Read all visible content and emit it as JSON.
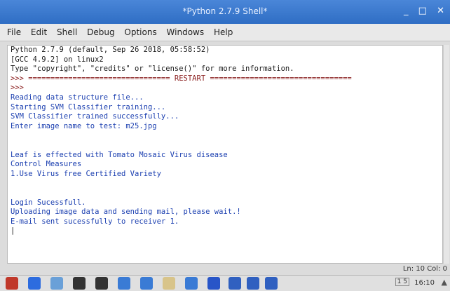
{
  "window": {
    "title": "*Python 2.7.9 Shell*",
    "controls": [
      "_",
      "□",
      "✕"
    ]
  },
  "menu": [
    "File",
    "Edit",
    "Shell",
    "Debug",
    "Options",
    "Windows",
    "Help"
  ],
  "shell": {
    "lines": [
      {
        "text": "Python 2.7.9 (default, Sep 26 2018, 05:58:52)",
        "style": "out"
      },
      {
        "text": "[GCC 4.9.2] on linux2",
        "style": "out"
      },
      {
        "text": "Type \"copyright\", \"credits\" or \"license()\" for more information.",
        "style": "out"
      },
      {
        "text": ">>> ================================ RESTART ================================",
        "style": "prompt"
      },
      {
        "text": ">>> ",
        "style": "prompt"
      },
      {
        "text": "Reading data structure file...",
        "style": "blue"
      },
      {
        "text": "Starting SVM Classifier training...",
        "style": "blue"
      },
      {
        "text": "SVM Classifier trained successfully...",
        "style": "blue"
      },
      {
        "text": "Enter image name to test: m25.jpg",
        "style": "blue"
      },
      {
        "text": "",
        "style": "out"
      },
      {
        "text": "",
        "style": "out"
      },
      {
        "text": "Leaf is effected with Tomato Mosaic Virus disease",
        "style": "blue"
      },
      {
        "text": "Control Measures",
        "style": "blue"
      },
      {
        "text": "1.Use Virus free Certified Variety",
        "style": "blue"
      },
      {
        "text": "",
        "style": "out"
      },
      {
        "text": "",
        "style": "out"
      },
      {
        "text": "Login Sucessfull.",
        "style": "blue"
      },
      {
        "text": "Uploading image data and sending mail, please wait.!",
        "style": "blue"
      },
      {
        "text": "E-mail sent sucessfully to receiver 1.",
        "style": "blue"
      },
      {
        "text": "|",
        "style": "out"
      }
    ]
  },
  "status": "Ln: 10 Col: 0",
  "taskbar": {
    "icons": [
      {
        "name": "raspberry-menu-icon",
        "color": "#c0392b"
      },
      {
        "name": "web-browser-icon",
        "color": "#2d6cdf"
      },
      {
        "name": "file-manager-icon",
        "color": "#6aa0d8"
      },
      {
        "name": "terminal-icon",
        "color": "#333333"
      },
      {
        "name": "terminal-icon-2",
        "color": "#333333"
      },
      {
        "name": "python-idle-icon",
        "color": "#3a7bd5"
      },
      {
        "name": "python-idle-icon-2",
        "color": "#3a7bd5"
      },
      {
        "name": "folder-icon",
        "color": "#d8c48a"
      },
      {
        "name": "python-idle-icon-3",
        "color": "#3a7bd5"
      },
      {
        "name": "vnc-icon",
        "color": "#2855c8"
      },
      {
        "name": "bluetooth-icon",
        "color": "#3060c0"
      },
      {
        "name": "wifi-icon",
        "color": "#3060c0"
      },
      {
        "name": "volume-icon",
        "color": "#3060c0"
      }
    ],
    "lang": "1 5",
    "clock": "16:10",
    "eject": "▲"
  }
}
